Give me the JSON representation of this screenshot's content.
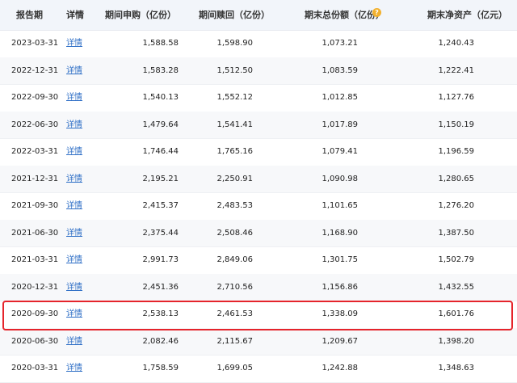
{
  "table": {
    "headers": {
      "date": "报告期",
      "detail": "详情",
      "subscription": "期间申购（亿份）",
      "redemption": "期间赎回（亿份）",
      "total_shares": "期末总份额（亿份）",
      "net_assets": "期末净资产（亿元）"
    },
    "help_icon": "?",
    "highlight_color": "#e5242b",
    "link_color": "#2f6fc6",
    "rows": [
      {
        "date": "2023-03-31",
        "detail": "详情",
        "subscription": "1,588.58",
        "redemption": "1,598.90",
        "total_shares": "1,073.21",
        "net_assets": "1,240.43"
      },
      {
        "date": "2022-12-31",
        "detail": "详情",
        "subscription": "1,583.28",
        "redemption": "1,512.50",
        "total_shares": "1,083.59",
        "net_assets": "1,222.41"
      },
      {
        "date": "2022-09-30",
        "detail": "详情",
        "subscription": "1,540.13",
        "redemption": "1,552.12",
        "total_shares": "1,012.85",
        "net_assets": "1,127.76"
      },
      {
        "date": "2022-06-30",
        "detail": "详情",
        "subscription": "1,479.64",
        "redemption": "1,541.41",
        "total_shares": "1,017.89",
        "net_assets": "1,150.19"
      },
      {
        "date": "2022-03-31",
        "detail": "详情",
        "subscription": "1,746.44",
        "redemption": "1,765.16",
        "total_shares": "1,079.41",
        "net_assets": "1,196.59"
      },
      {
        "date": "2021-12-31",
        "detail": "详情",
        "subscription": "2,195.21",
        "redemption": "2,250.91",
        "total_shares": "1,090.98",
        "net_assets": "1,280.65"
      },
      {
        "date": "2021-09-30",
        "detail": "详情",
        "subscription": "2,415.37",
        "redemption": "2,483.53",
        "total_shares": "1,101.65",
        "net_assets": "1,276.20"
      },
      {
        "date": "2021-06-30",
        "detail": "详情",
        "subscription": "2,375.44",
        "redemption": "2,508.46",
        "total_shares": "1,168.90",
        "net_assets": "1,387.50"
      },
      {
        "date": "2021-03-31",
        "detail": "详情",
        "subscription": "2,991.73",
        "redemption": "2,849.06",
        "total_shares": "1,301.75",
        "net_assets": "1,502.79"
      },
      {
        "date": "2020-12-31",
        "detail": "详情",
        "subscription": "2,451.36",
        "redemption": "2,710.56",
        "total_shares": "1,156.86",
        "net_assets": "1,432.55"
      },
      {
        "date": "2020-09-30",
        "detail": "详情",
        "subscription": "2,538.13",
        "redemption": "2,461.53",
        "total_shares": "1,338.09",
        "net_assets": "1,601.76"
      },
      {
        "date": "2020-06-30",
        "detail": "详情",
        "subscription": "2,082.46",
        "redemption": "2,115.67",
        "total_shares": "1,209.67",
        "net_assets": "1,398.20"
      },
      {
        "date": "2020-03-31",
        "detail": "详情",
        "subscription": "1,758.59",
        "redemption": "1,699.05",
        "total_shares": "1,242.88",
        "net_assets": "1,348.63"
      }
    ]
  }
}
